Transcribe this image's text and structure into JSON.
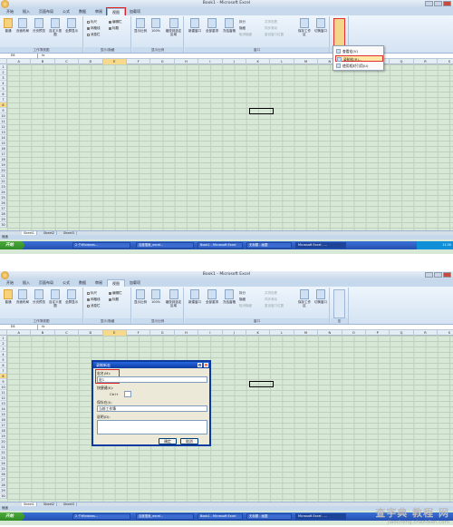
{
  "window": {
    "title": "Book1 - Microsoft Excel"
  },
  "tabs": [
    "开始",
    "插入",
    "页面布局",
    "公式",
    "数据",
    "审阅",
    "视图",
    "加载项"
  ],
  "ribbon": {
    "workbook_views": {
      "label": "工作簿视图",
      "buttons": [
        "普通",
        "页面布局",
        "分页预览",
        "自定义视图",
        "全屏显示"
      ]
    },
    "show_hide": {
      "label": "显示/隐藏",
      "checks": [
        "标尺",
        "网格线",
        "消息栏",
        "编辑栏",
        "标题"
      ]
    },
    "zoom": {
      "label": "显示比例",
      "buttons": [
        "显示比例",
        "100%",
        "缩放到选定区域"
      ]
    },
    "window_group": {
      "label": "窗口",
      "buttons": [
        "新建窗口",
        "全部重排",
        "冻结窗格"
      ],
      "small": [
        "拆分",
        "隐藏",
        "取消隐藏",
        "并排查看",
        "同步滚动",
        "重设窗口位置"
      ],
      "big": [
        "保存工作区",
        "切换窗口"
      ]
    },
    "macros": {
      "label": "宏"
    }
  },
  "name_box": "E8",
  "fx": "fx",
  "columns": [
    "A",
    "B",
    "C",
    "D",
    "E",
    "F",
    "G",
    "H",
    "I",
    "J",
    "K",
    "L",
    "M",
    "N",
    "O",
    "P",
    "Q",
    "R",
    "S"
  ],
  "rows": [
    "1",
    "2",
    "3",
    "4",
    "5",
    "6",
    "7",
    "8",
    "9",
    "10",
    "11",
    "12",
    "13",
    "14",
    "15",
    "16",
    "17",
    "18",
    "19",
    "20",
    "21",
    "22",
    "23",
    "24",
    "25",
    "26",
    "27",
    "28",
    "29",
    "30"
  ],
  "sheets": [
    "Sheet1",
    "Sheet2",
    "Sheet3"
  ],
  "status": "就绪",
  "taskbar": {
    "start": "开始",
    "items": [
      "2 个Windows...",
      "百度搜索_excel...",
      "Book1 - Microsoft Excel",
      "无标题 - 画图",
      "Microsoft Excel - ..."
    ],
    "tray": "11:30"
  },
  "macro_menu": {
    "items": [
      "查看宏(V)",
      "录制宏(R)...",
      "使用相对引用(U)"
    ]
  },
  "dialog": {
    "title": "录制新宏",
    "help": "?",
    "close": "X",
    "macro_name_label": "宏名(M):",
    "macro_name_value": "宏1",
    "shortcut_label": "快捷键(K):",
    "ctrl_prefix": "Ctrl+",
    "store_label": "保存在(I):",
    "store_value": "当前工作簿",
    "desc_label": "说明(D):",
    "ok": "确定",
    "cancel": "取消"
  },
  "watermark": {
    "line1": "查字典 教程 网",
    "line2": "jiaocheng.chazidian.com"
  }
}
